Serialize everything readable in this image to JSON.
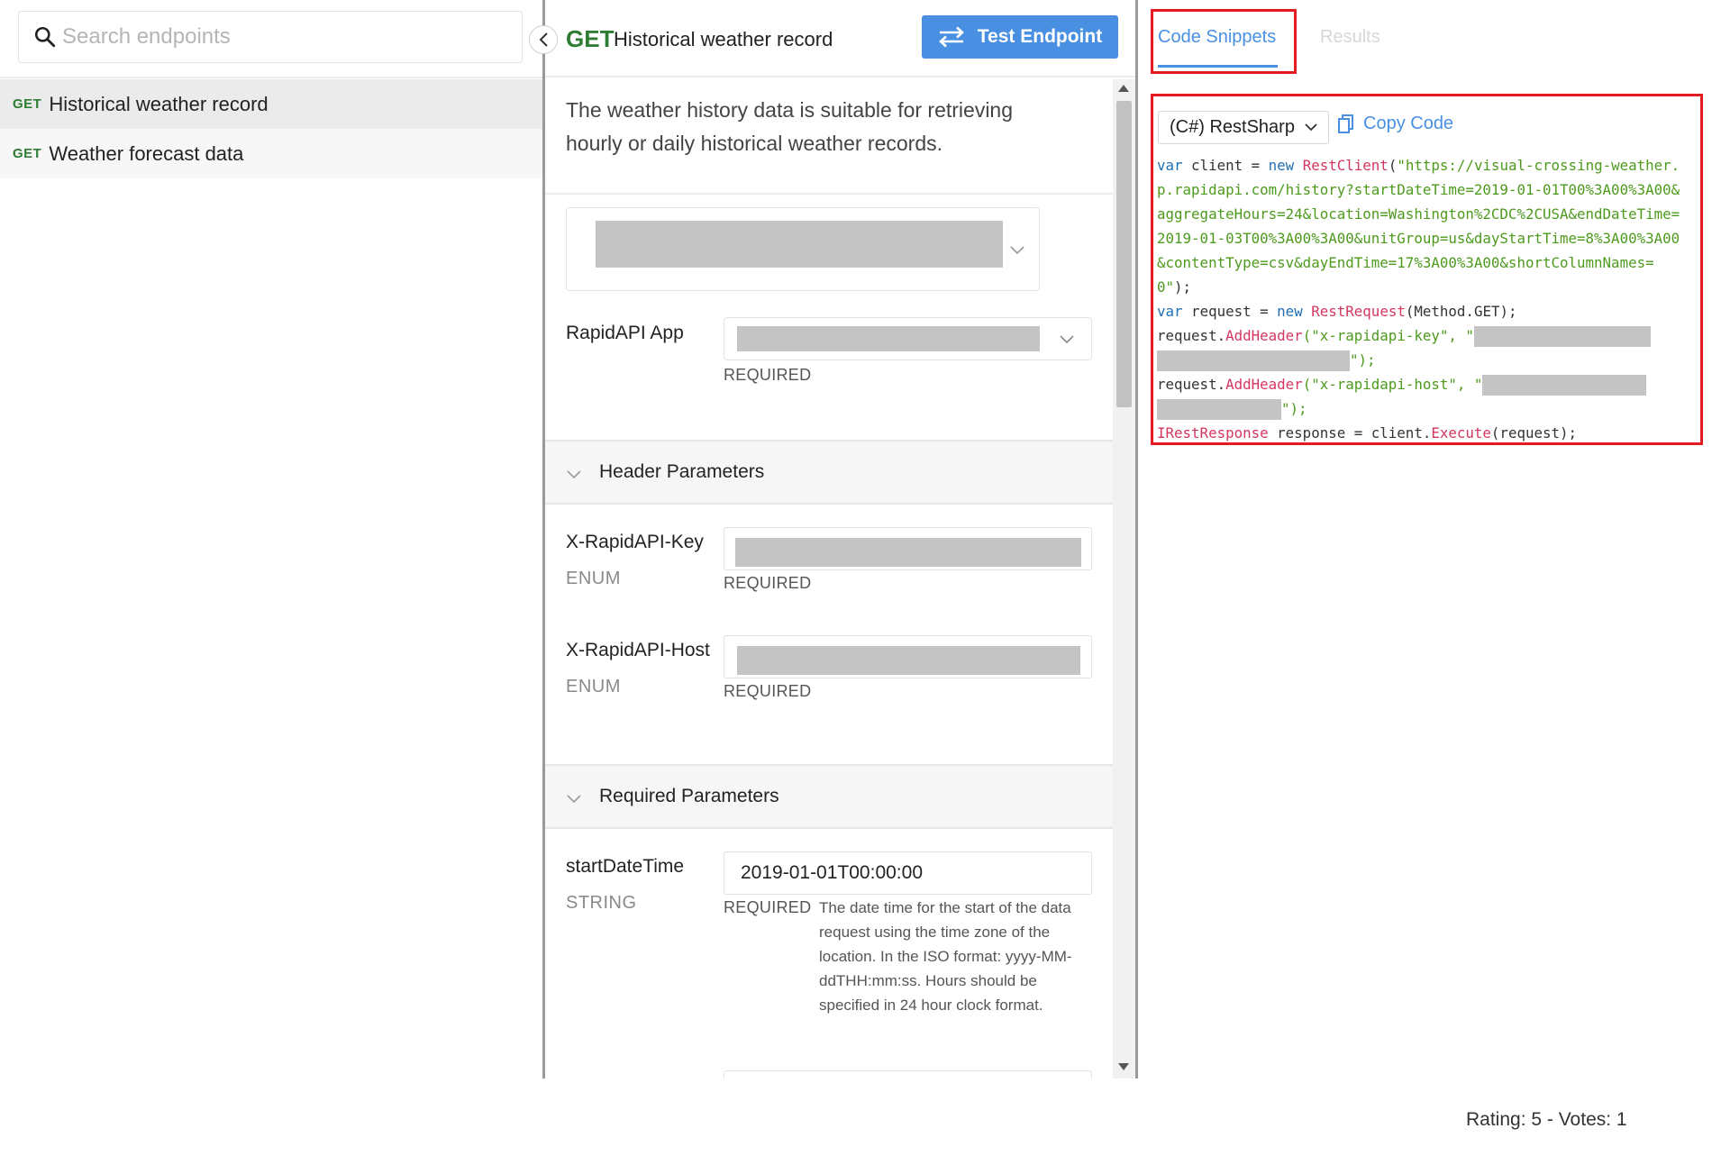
{
  "sidebar": {
    "search_placeholder": "Search endpoints",
    "endpoints": [
      {
        "method": "GET",
        "name": "Historical weather record",
        "active": true
      },
      {
        "method": "GET",
        "name": "Weather forecast data",
        "active": false
      }
    ]
  },
  "endpoint": {
    "method": "GET",
    "title": "Historical weather record",
    "test_button_label": "Test Endpoint",
    "description": "The weather history data is suitable for retrieving hourly or daily historical weather records.",
    "rapidapi_app_label": "RapidAPI App",
    "required_label": "REQUIRED",
    "header_section_title": "Header Parameters",
    "required_section_title": "Required Parameters",
    "header_params": [
      {
        "name": "X-RapidAPI-Key",
        "type": "ENUM",
        "required": "REQUIRED"
      },
      {
        "name": "X-RapidAPI-Host",
        "type": "ENUM",
        "required": "REQUIRED"
      }
    ],
    "required_params": [
      {
        "name": "startDateTime",
        "type": "STRING",
        "value": "2019-01-01T00:00:00",
        "required": "REQUIRED",
        "description": "The date time for the start of the data request using the time zone of the location. In the ISO format: yyyy-MM-ddTHH:mm:ss. Hours should be specified in 24 hour clock format."
      }
    ]
  },
  "code_panel": {
    "tab_code": "Code Snippets",
    "tab_results": "Results",
    "language": "(C#) RestSharp",
    "copy_label": "Copy Code",
    "code": {
      "l1_kw": "var",
      "l1_mid": " client = ",
      "l1_new": "new",
      "l1_cls": " RestClient",
      "l1_open": "(",
      "url_lines": [
        "\"https://visual-crossing-weather.",
        "p.rapidapi.com/history?startDateTime=2019-01-01T00%3A00%3A00&",
        "aggregateHours=24&location=Washington%2CDC%2CUSA&endDateTime=",
        "2019-01-03T00%3A00%3A00&unitGroup=us&dayStartTime=8%3A00%3A00",
        "&contentType=csv&dayEndTime=17%3A00%3A00&shortColumnNames=",
        "0\""
      ],
      "close_paren": ");",
      "l2_kw": "var",
      "l2_mid": " request = ",
      "l2_new": "new",
      "l2_cls": " RestRequest",
      "l2_rest": "(Method.GET);",
      "req_prefix": "request.",
      "add_header": "AddHeader",
      "key_header": "(\"x-rapidapi-key\", \"",
      "host_header": "(\"x-rapidapi-host\", \"",
      "str_close": "\");",
      "l_last_cls": "IRestResponse",
      "l_last_mid": " response = client.",
      "l_last_exec": "Execute",
      "l_last_end": "(request);"
    }
  },
  "footer": {
    "rating_text": "Rating: 5 - Votes: 1"
  },
  "colors": {
    "accent_blue": "#4a90e2",
    "method_green": "#2e7d32",
    "highlight_red": "#e31b23",
    "code_keyword": "#1f6fb5",
    "code_string": "#4d9a1d",
    "code_class": "#d4365f"
  }
}
